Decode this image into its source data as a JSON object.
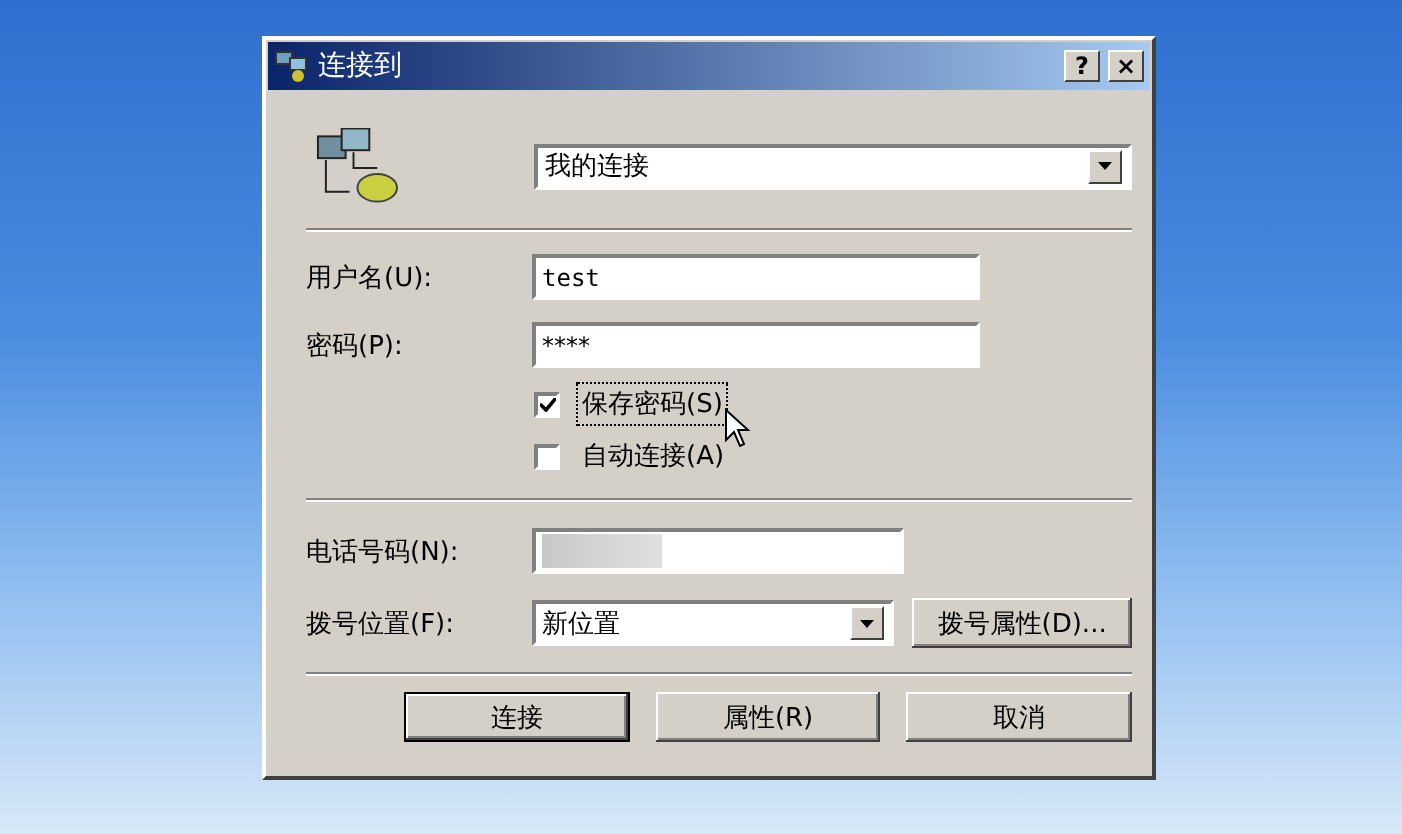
{
  "window": {
    "title": "连接到",
    "title_buttons": [
      "?",
      "×"
    ]
  },
  "connection": {
    "value": "我的连接"
  },
  "username": {
    "label": "用户名(U):",
    "value": "test"
  },
  "password": {
    "label": "密码(P):",
    "value": "****"
  },
  "options": [
    {
      "label": "保存密码(S)",
      "checked": true,
      "focused": true
    },
    {
      "label": "自动连接(A)",
      "checked": false,
      "focused": false
    }
  ],
  "phone": {
    "label": "电话号码(N):",
    "redacted": true
  },
  "location": {
    "label": "拨号位置(F):",
    "value": "新位置",
    "button": "拨号属性(D)..."
  },
  "buttons": [
    {
      "label": "连接",
      "default": true
    },
    {
      "label": "属性(R)",
      "default": false
    },
    {
      "label": "取消",
      "default": false
    }
  ]
}
